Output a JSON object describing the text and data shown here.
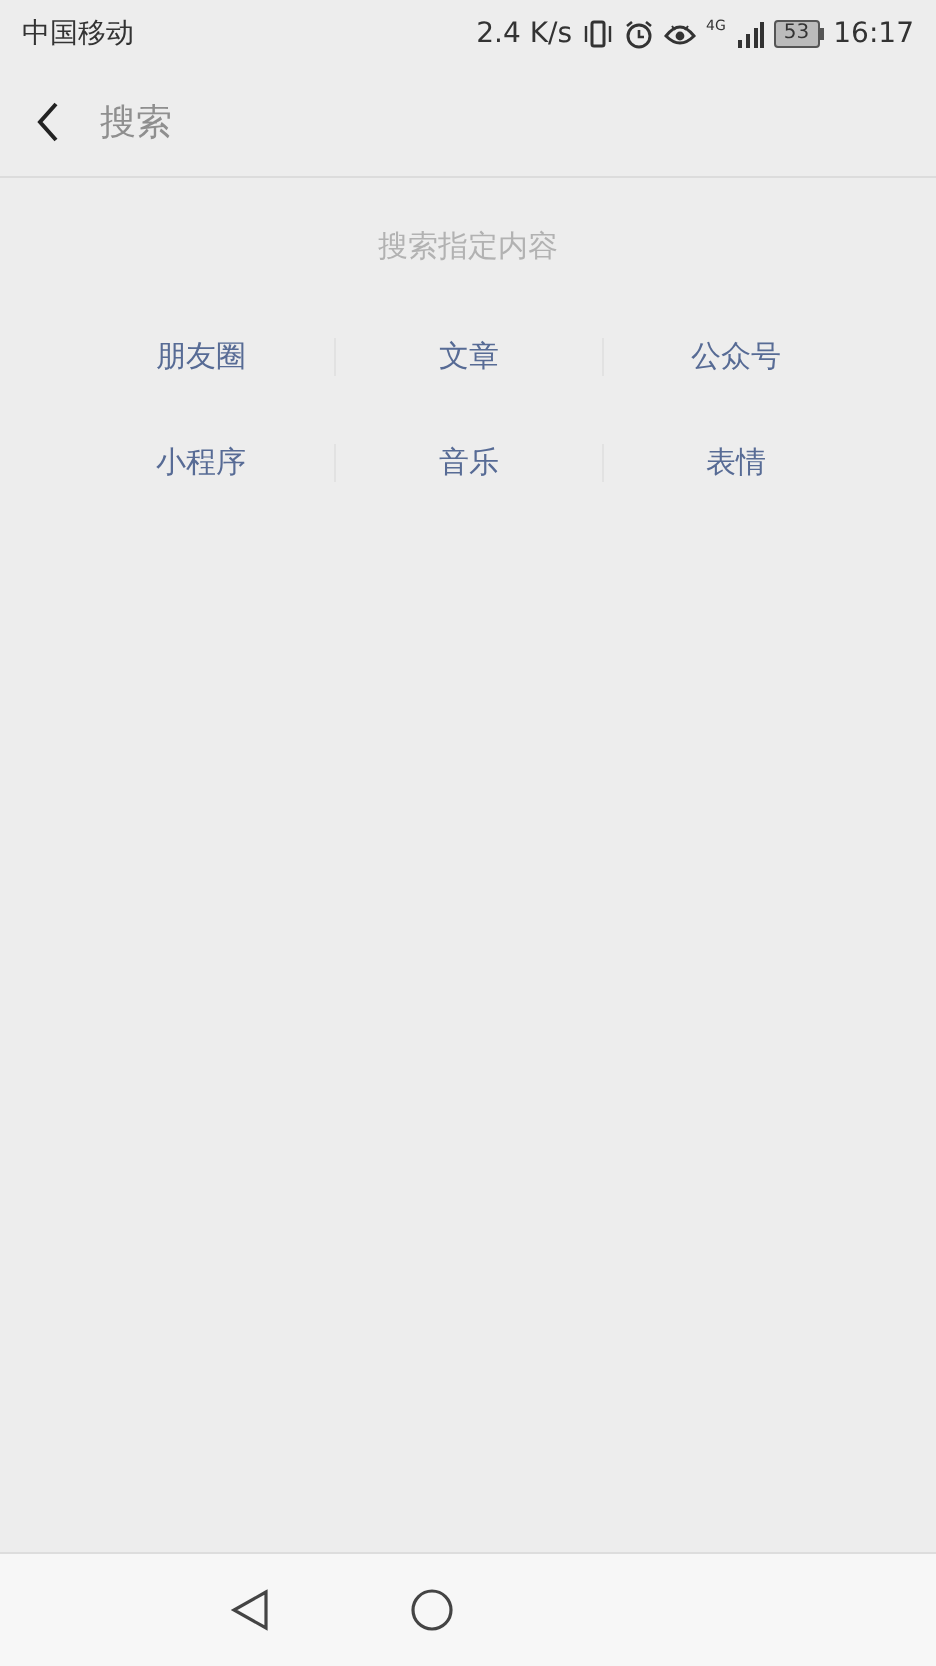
{
  "status_bar": {
    "carrier": "中国移动",
    "speed": "2.4 K/s",
    "network": "4G",
    "battery": "53",
    "time": "16:17"
  },
  "search_bar": {
    "placeholder": "搜索"
  },
  "hint": "搜索指定内容",
  "categories": [
    [
      "朋友圈",
      "文章",
      "公众号"
    ],
    [
      "小程序",
      "音乐",
      "表情"
    ]
  ]
}
